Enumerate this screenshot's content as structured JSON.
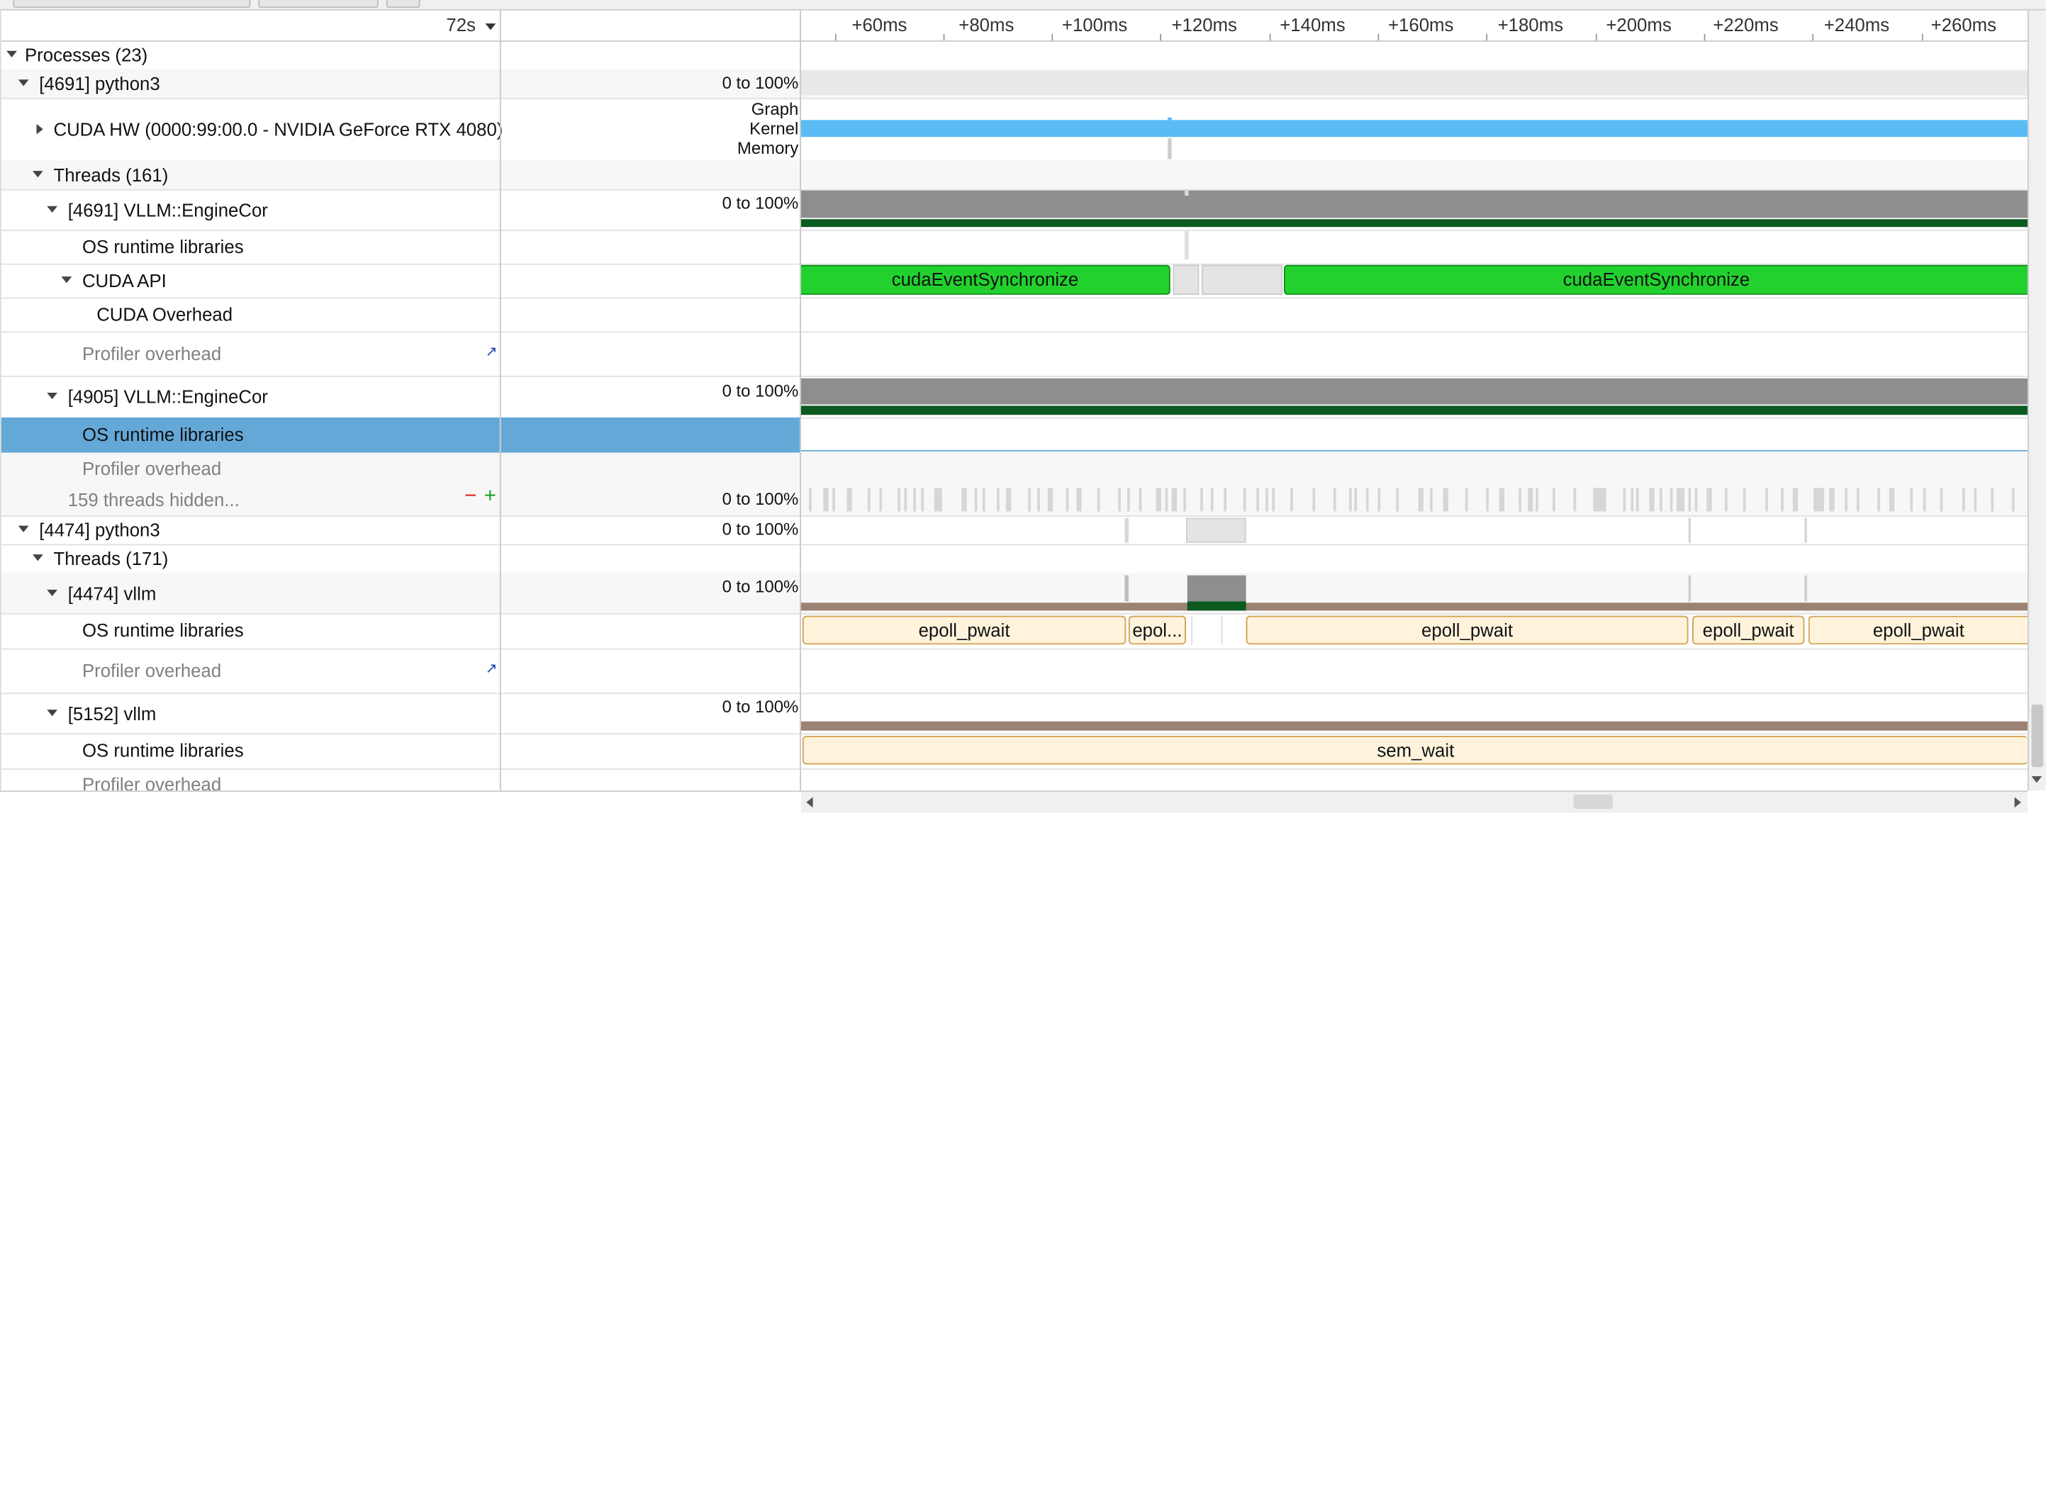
{
  "header": {
    "zoom_label": "72s",
    "ruler_ticks": [
      "+60ms",
      "+80ms",
      "+100ms",
      "+120ms",
      "+140ms",
      "+160ms",
      "+180ms",
      "+200ms",
      "+220ms",
      "+240ms",
      "+260ms"
    ]
  },
  "rows": {
    "processes": "Processes (23)",
    "p4691": "[4691] python3",
    "p4691_scale": "0 to 100%",
    "cuda_hw": "CUDA HW (0000:99:00.0 - NVIDIA GeForce RTX 4080)",
    "cuda_hw_graph": "Graph",
    "cuda_hw_kernel": "Kernel",
    "cuda_hw_memory": "Memory",
    "threads161": "Threads (161)",
    "t4691": "[4691] VLLM::EngineCor",
    "t4691_scale": "0 to 100%",
    "os_runtime_1": "OS runtime libraries",
    "cuda_api": "CUDA API",
    "cuda_api_event1": "cudaEventSynchronize",
    "cuda_api_event2": "cudaEventSynchronize",
    "cuda_overhead": "CUDA Overhead",
    "profiler_overhead_1": "Profiler overhead",
    "t4905": "[4905] VLLM::EngineCor",
    "t4905_scale": "0 to 100%",
    "os_runtime_2": "OS runtime libraries",
    "profiler_overhead_2": "Profiler overhead",
    "hidden_threads": "159 threads hidden...",
    "hidden_scale": "0 to 100%",
    "p4474": "[4474] python3",
    "p4474_scale": "0 to 100%",
    "threads171": "Threads (171)",
    "t4474": "[4474] vllm",
    "t4474_scale": "0 to 100%",
    "os_runtime_3": "OS runtime libraries",
    "epoll_1": "epoll_pwait",
    "epoll_2": "epol...",
    "epoll_3": "epoll_pwait",
    "epoll_4": "epoll_pwait",
    "epoll_5": "epoll_pwait",
    "profiler_overhead_3": "Profiler overhead",
    "t5152": "[5152] vllm",
    "t5152_scale": "0 to 100%",
    "os_runtime_4": "OS runtime libraries",
    "sem_wait": "sem_wait",
    "profiler_overhead_4": "Profiler overhead"
  },
  "colors": {
    "cuda_kernel": "#5bbcf5",
    "cuda_api_green": "#22d12e",
    "thread_util_grey": "#8e8e8e",
    "thread_dark_green": "#0b5a20",
    "vllm_brown": "#9c8272",
    "epoll_fill": "#fff3dc",
    "selection": "#64a8d8"
  }
}
